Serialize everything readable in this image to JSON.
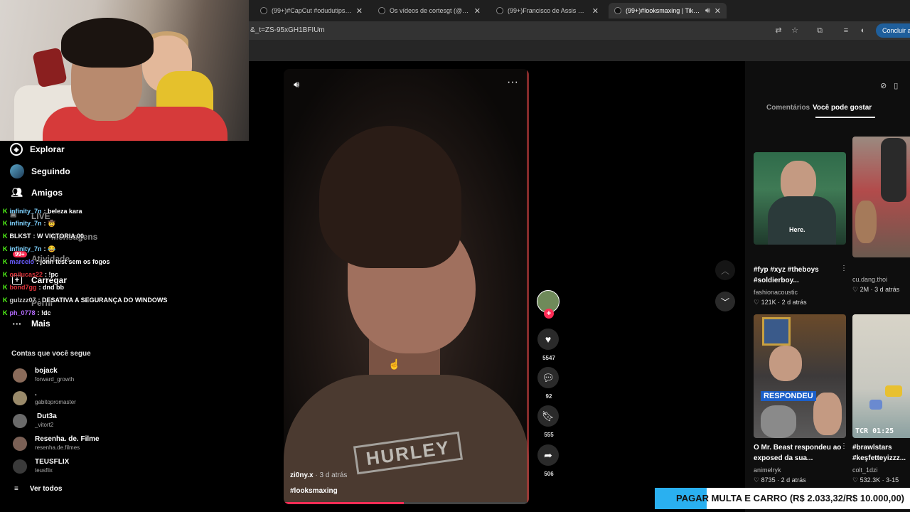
{
  "browser": {
    "tabs": [
      {
        "title": "(99+)#CapCut #odudutips | TikTo",
        "active": false
      },
      {
        "title": "Os vídeos de cortesgt (@cortes",
        "active": false
      },
      {
        "title": "(99+)Francisco de Assis Pereira",
        "active": false
      },
      {
        "title": "(99+)#looksmaxing | TikTok",
        "active": true
      }
    ],
    "url": "&_t=ZS-95xGH1BFIUm",
    "finish_button": "Concluir at"
  },
  "sidebar": {
    "nav": [
      {
        "label": "Explorar",
        "icon": "compass-icon"
      },
      {
        "label": "Seguindo",
        "icon": "following-avatar-icon"
      },
      {
        "label": "Amigos",
        "icon": "friends-icon"
      }
    ],
    "ghost_items": {
      "live": "LIVE",
      "messages": "Mensagens",
      "badge": "99+",
      "activity": "Atividade",
      "profile": "Perfil"
    },
    "upload_label": "Carregar",
    "more_label": "Mais",
    "following_title": "Contas que você segue",
    "accounts": [
      {
        "name": "bojack",
        "handle": "forward_growth"
      },
      {
        "name": ".",
        "handle": "gabitopromaster"
      },
      {
        "name": "Dut3a",
        "handle": "_vitort2"
      },
      {
        "name": "Resenha. de. Filme",
        "handle": "resenha.de.filmes"
      },
      {
        "name": "TEUSFLIX",
        "handle": "teusflix"
      }
    ],
    "see_all": "Ver todos"
  },
  "chat": [
    {
      "user": "infinity_7n",
      "msg": ": beleza kara",
      "color": "#7fd3ff"
    },
    {
      "user": "infinity_7n",
      "msg": ": 🤠",
      "color": "#7fd3ff"
    },
    {
      "user": "BLKST",
      "msg": ": W VICTORIA 00",
      "color": "#ffffff"
    },
    {
      "user": "infinity_7n",
      "msg": ": 😂",
      "color": "#7fd3ff"
    },
    {
      "user": "marcelo",
      "msg": ": jonh test sem os fogos",
      "color": "#6a5cff"
    },
    {
      "user": "onilucas22",
      "msg": ": !pc",
      "color": "#e0343b"
    },
    {
      "user": "bond7gg",
      "msg": ": dnd bb",
      "color": "#e0343b"
    },
    {
      "user": "gulzzz07",
      "msg": ": DESATIVA A SEGURANÇA DO WINDOWS",
      "color": "#c8c8c8"
    },
    {
      "user": "ph_0778",
      "msg": ": !dc",
      "color": "#b46bff"
    }
  ],
  "video": {
    "author": "zi0ny.x",
    "time": " · 3 d atrás",
    "hashtag": "#looksmaxing",
    "shirt_text": "HURLEY",
    "progress": 0.49,
    "likes": "5547",
    "comments": "92",
    "saves": "555",
    "shares": "506"
  },
  "right_panel": {
    "tabs": [
      "Comentários",
      "Você pode gostar"
    ],
    "active_tab": 1,
    "cards": [
      {
        "title": "#fyp #xyz #theboys #soldierboy...",
        "author": "fashionacoustic",
        "meta": "121K · 2 d atrás",
        "thumb_text": "Here.",
        "overlay": ""
      },
      {
        "title": "",
        "author": "cu.dang.thoi",
        "meta": "2M · 3 d atrás",
        "thumb_text": "",
        "overlay": ""
      },
      {
        "title": "O Mr. Beast respondeu ao exposed da sua...",
        "author": "animelryk",
        "meta": "8735 · 2 d atrás",
        "thumb_text": "",
        "overlay": "RESPONDEU"
      },
      {
        "title": "#brawlstars #keşfetteyizzz...",
        "author": "colt_1dzi",
        "meta": "532.3K · 3-15",
        "thumb_text": "",
        "overlay": "TCR 01:25"
      }
    ]
  },
  "banner": {
    "text_strong": "PAGAR",
    "text_rest": " MULTA E CARRO (R$ 2.033,32/R$ 10.000,00)",
    "progress": 0.2033
  }
}
